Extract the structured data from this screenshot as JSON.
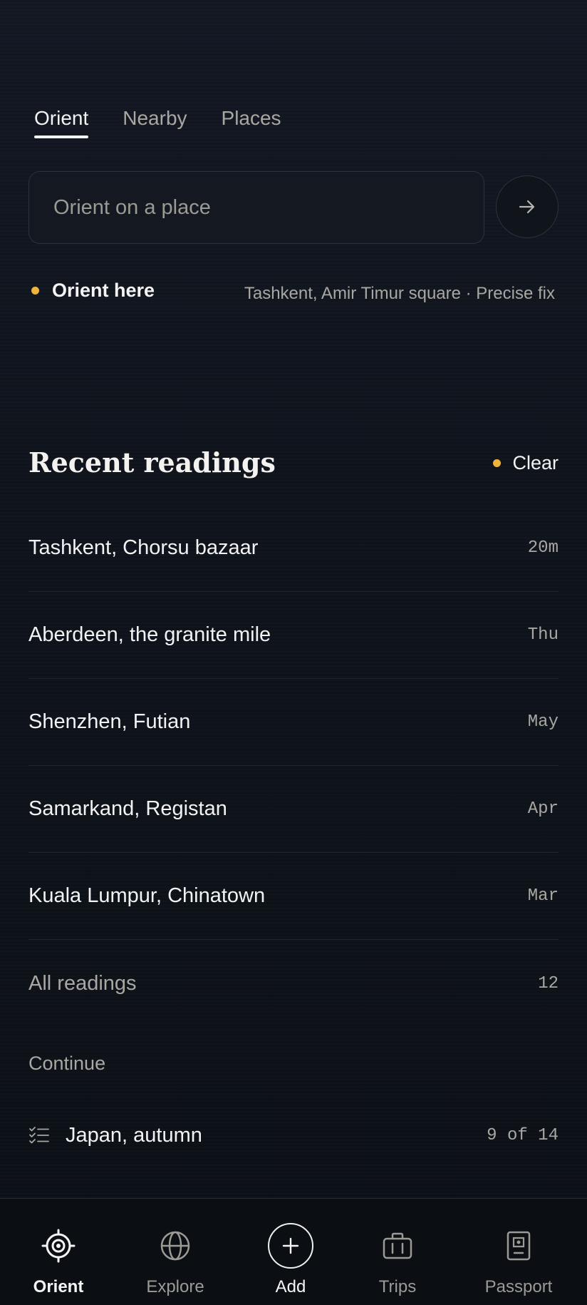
{
  "tabs": [
    {
      "label": "Orient",
      "active": true
    },
    {
      "label": "Nearby",
      "active": false
    },
    {
      "label": "Places",
      "active": false
    }
  ],
  "search": {
    "placeholder": "Orient on a place",
    "value": ""
  },
  "orient_here": {
    "label": "Orient here",
    "meta": "Tashkent, Amir Timur square · Precise fix"
  },
  "recent": {
    "title": "Recent readings",
    "clear_label": "Clear",
    "items": [
      {
        "name": "Tashkent, Chorsu bazaar",
        "time": "20m"
      },
      {
        "name": "Aberdeen, the granite mile",
        "time": "Thu"
      },
      {
        "name": "Shenzhen, Futian",
        "time": "May"
      },
      {
        "name": "Samarkand, Registan",
        "time": "Apr"
      },
      {
        "name": "Kuala Lumpur, Chinatown",
        "time": "Mar"
      }
    ],
    "all_label": "All readings",
    "all_count": "12"
  },
  "continue": {
    "label": "Continue",
    "trip_name": "Japan, autumn",
    "trip_progress": "9 of 14"
  },
  "nav": {
    "orient": "Orient",
    "explore": "Explore",
    "add": "Add",
    "trips": "Trips",
    "passport": "Passport"
  },
  "colors": {
    "accent": "#f0b43c",
    "background": "#0f131a",
    "muted_text": "#a9a7a2"
  }
}
